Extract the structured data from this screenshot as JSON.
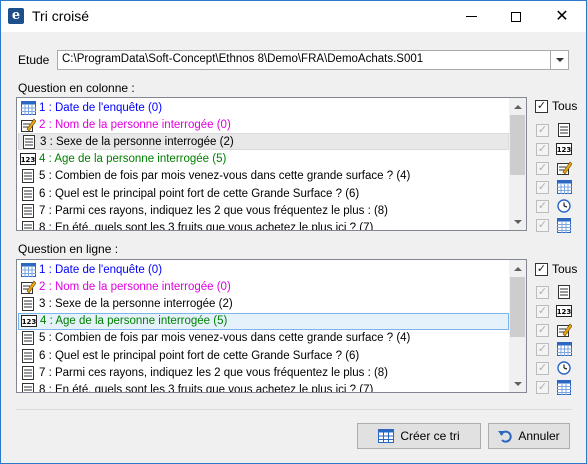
{
  "window": {
    "title": "Tri croisé"
  },
  "etude": {
    "label": "Etude",
    "value": "C:\\ProgramData\\Soft-Concept\\Ethnos 8\\Demo\\FRA\\DemoAchats.S001"
  },
  "colonne": {
    "label": "Question en colonne :",
    "tous_label": "Tous",
    "items": [
      {
        "text": "1 : Date de l'enquête (0)",
        "color": "#0000ff",
        "icon": "calendar-icon"
      },
      {
        "text": "2 : Nom de la personne interrogée (0)",
        "color": "#e000e0",
        "icon": "text-edit-icon"
      },
      {
        "text": "3 : Sexe de la personne interrogée (2)",
        "color": "#000000",
        "icon": "list-icon"
      },
      {
        "text": "4 : Age de la personne interrogée (5)",
        "color": "#008000",
        "icon": "numeric-icon"
      },
      {
        "text": "5 : Combien de fois par mois venez-vous dans cette grande surface ? (4)",
        "color": "#000000",
        "icon": "list-icon"
      },
      {
        "text": "6 : Quel est le principal point fort de cette Grande Surface ? (6)",
        "color": "#000000",
        "icon": "list-icon"
      },
      {
        "text": "7 : Parmi ces rayons, indiquez les 2 que vous fréquentez le plus : (8)",
        "color": "#000000",
        "icon": "list-icon"
      },
      {
        "text": "8 : En été, quels sont les 3 fruits que vous achetez le plus ici ? (7)",
        "color": "#000000",
        "icon": "list-icon"
      }
    ]
  },
  "ligne": {
    "label": "Question en ligne :",
    "tous_label": "Tous",
    "items": [
      {
        "text": "1 : Date de l'enquête (0)",
        "color": "#0000ff",
        "icon": "calendar-icon"
      },
      {
        "text": "2 : Nom de la personne interrogée (0)",
        "color": "#e000e0",
        "icon": "text-edit-icon"
      },
      {
        "text": "3 : Sexe de la personne interrogée (2)",
        "color": "#000000",
        "icon": "list-icon"
      },
      {
        "text": "4 : Age de la personne interrogée (5)",
        "color": "#008000",
        "icon": "numeric-icon"
      },
      {
        "text": "5 : Combien de fois par mois venez-vous dans cette grande surface ? (4)",
        "color": "#000000",
        "icon": "list-icon"
      },
      {
        "text": "6 : Quel est le principal point fort de cette Grande Surface ? (6)",
        "color": "#000000",
        "icon": "list-icon"
      },
      {
        "text": "7 : Parmi ces rayons, indiquez les 2 que vous fréquentez le plus : (8)",
        "color": "#000000",
        "icon": "list-icon"
      },
      {
        "text": "8 : En été, quels sont les 3 fruits que vous achetez le plus ici ? (7)",
        "color": "#000000",
        "icon": "list-icon"
      }
    ]
  },
  "type_filters": [
    "list-icon",
    "numeric-icon",
    "text-edit-icon",
    "calendar-icon",
    "clock-icon",
    "table-icon"
  ],
  "buttons": {
    "create_label": "Créer ce tri",
    "cancel_label": "Annuler"
  },
  "colors": {
    "accent_border": "#2b79c9",
    "selected_blue": "#e5f1fb"
  }
}
